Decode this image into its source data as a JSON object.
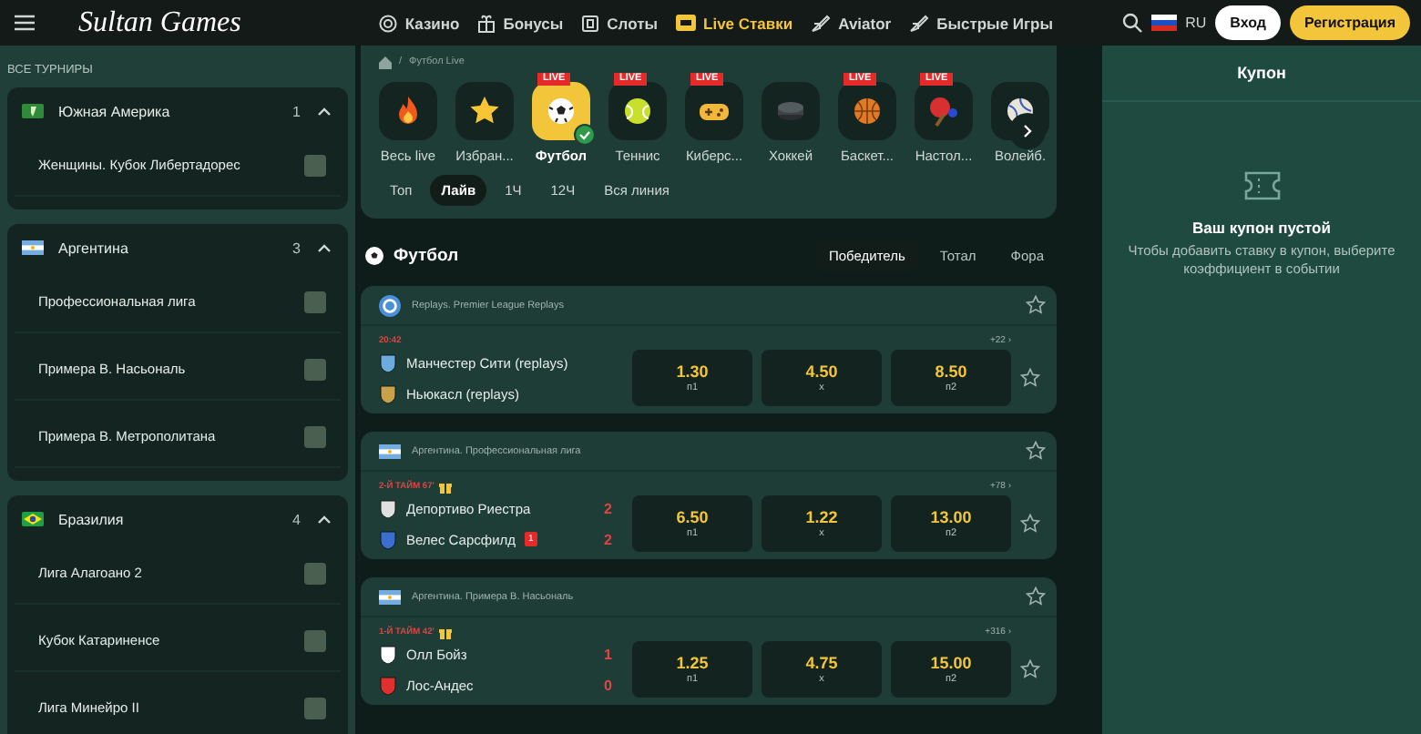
{
  "header": {
    "logo": "Sultan Games",
    "nav": [
      {
        "label": "Казино",
        "kind": "chip",
        "selected": false
      },
      {
        "label": "Бонусы",
        "kind": "gift",
        "selected": false
      },
      {
        "label": "Слоты",
        "kind": "slot",
        "selected": false
      },
      {
        "label": "Live Ставки",
        "kind": "tv",
        "selected": true
      },
      {
        "label": "Aviator",
        "kind": "plane",
        "selected": false
      },
      {
        "label": "Быстрые Игры",
        "kind": "plane",
        "selected": false
      }
    ],
    "language": "RU",
    "login": "Вход",
    "register": "Регистрация"
  },
  "sidebar": {
    "title": "ВСЕ ТУРНИРЫ",
    "groups": [
      {
        "name": "Южная Америка",
        "kind": "globe",
        "count": "1",
        "expanded": true,
        "items": [
          {
            "name": "Женщины. Кубок Либертадорес",
            "checked": false
          }
        ]
      },
      {
        "name": "Аргентина",
        "kind": "argentina",
        "count": "3",
        "expanded": true,
        "items": [
          {
            "name": "Профессиональная лига",
            "checked": false
          },
          {
            "name": "Примера В. Насьональ",
            "checked": false
          },
          {
            "name": "Примера В. Метрополитана",
            "checked": false
          }
        ]
      },
      {
        "name": "Бразилия",
        "kind": "brazil",
        "count": "4",
        "expanded": true,
        "items": [
          {
            "name": "Лига Алагоано 2",
            "checked": false
          },
          {
            "name": "Кубок Катариненсе",
            "checked": false
          },
          {
            "name": "Лига Минейро II",
            "checked": false
          }
        ]
      }
    ]
  },
  "breadcrumb": {
    "separator": "/",
    "items": [
      "Футбол Live"
    ]
  },
  "sports": [
    {
      "label": "Весь live",
      "kind": "fire",
      "selected": false
    },
    {
      "label": "Избран...",
      "kind": "star",
      "selected": false
    },
    {
      "label": "Футбол",
      "kind": "football",
      "live_badge": "LIVE",
      "selected": true
    },
    {
      "label": "Теннис",
      "kind": "tennis",
      "live_badge": "LIVE",
      "selected": false
    },
    {
      "label": "Киберс...",
      "kind": "gamepad",
      "live_badge": "LIVE",
      "selected": false
    },
    {
      "label": "Хоккей",
      "kind": "puck",
      "selected": false
    },
    {
      "label": "Баскет...",
      "kind": "basketball",
      "live_badge": "LIVE",
      "selected": false
    },
    {
      "label": "Настол...",
      "kind": "pingpong",
      "live_badge": "LIVE",
      "selected": false
    },
    {
      "label": "Волейб.",
      "kind": "volleyball",
      "selected": false
    }
  ],
  "periods": [
    {
      "label": "Топ",
      "selected": false
    },
    {
      "label": "Лайв",
      "selected": true
    },
    {
      "label": "1Ч",
      "selected": false
    },
    {
      "label": "12Ч",
      "selected": false
    },
    {
      "label": "Вся линия",
      "selected": false
    }
  ],
  "section": {
    "title": "Футбол",
    "markets": [
      {
        "label": "Победитель",
        "selected": true
      },
      {
        "label": "Тотал",
        "selected": false
      },
      {
        "label": "Фора",
        "selected": false
      }
    ]
  },
  "events": [
    {
      "league": "Replays. Premier League Replays",
      "kind": "replays",
      "time": "20:42",
      "gift": false,
      "more": "+22 ›",
      "favorite": false,
      "teams": [
        {
          "name": "Манчестер Сити (replays)",
          "color": "#6cabdd"
        },
        {
          "name": "Ньюкасл (replays)",
          "color": "#c8a24a"
        }
      ],
      "odds": [
        {
          "value": "1.30",
          "label": "п1"
        },
        {
          "value": "4.50",
          "label": "x"
        },
        {
          "value": "8.50",
          "label": "п2"
        }
      ]
    },
    {
      "league": "Аргентина. Профессиональная лига",
      "kind": "argentina",
      "time": "2-Й ТАЙМ 67'",
      "gift": true,
      "more": "+78 ›",
      "favorite": false,
      "teams": [
        {
          "name": "Депортиво Риестра",
          "color": "#e0e0e0",
          "score": "2"
        },
        {
          "name": "Велес Сарсфилд",
          "color": "#3a6fd0",
          "score": "2",
          "red_cards": "1"
        }
      ],
      "odds": [
        {
          "value": "6.50",
          "label": "п1"
        },
        {
          "value": "1.22",
          "label": "x"
        },
        {
          "value": "13.00",
          "label": "п2"
        }
      ]
    },
    {
      "league": "Аргентина. Примера В. Насьональ",
      "kind": "argentina",
      "time": "1-Й ТАЙМ 42'",
      "gift": true,
      "more": "+316 ›",
      "favorite": false,
      "teams": [
        {
          "name": "Олл Бойз",
          "color": "#ffffff",
          "score": "1"
        },
        {
          "name": "Лос-Андес",
          "color": "#e03030",
          "score": "0"
        }
      ],
      "odds": [
        {
          "value": "1.25",
          "label": "п1"
        },
        {
          "value": "4.75",
          "label": "x"
        },
        {
          "value": "15.00",
          "label": "п2"
        }
      ]
    }
  ],
  "coupon": {
    "title": "Купон",
    "empty_title": "Ваш купон пустой",
    "empty_text": "Чтобы добавить ставку в купон, выберите коэффициент в событии"
  }
}
